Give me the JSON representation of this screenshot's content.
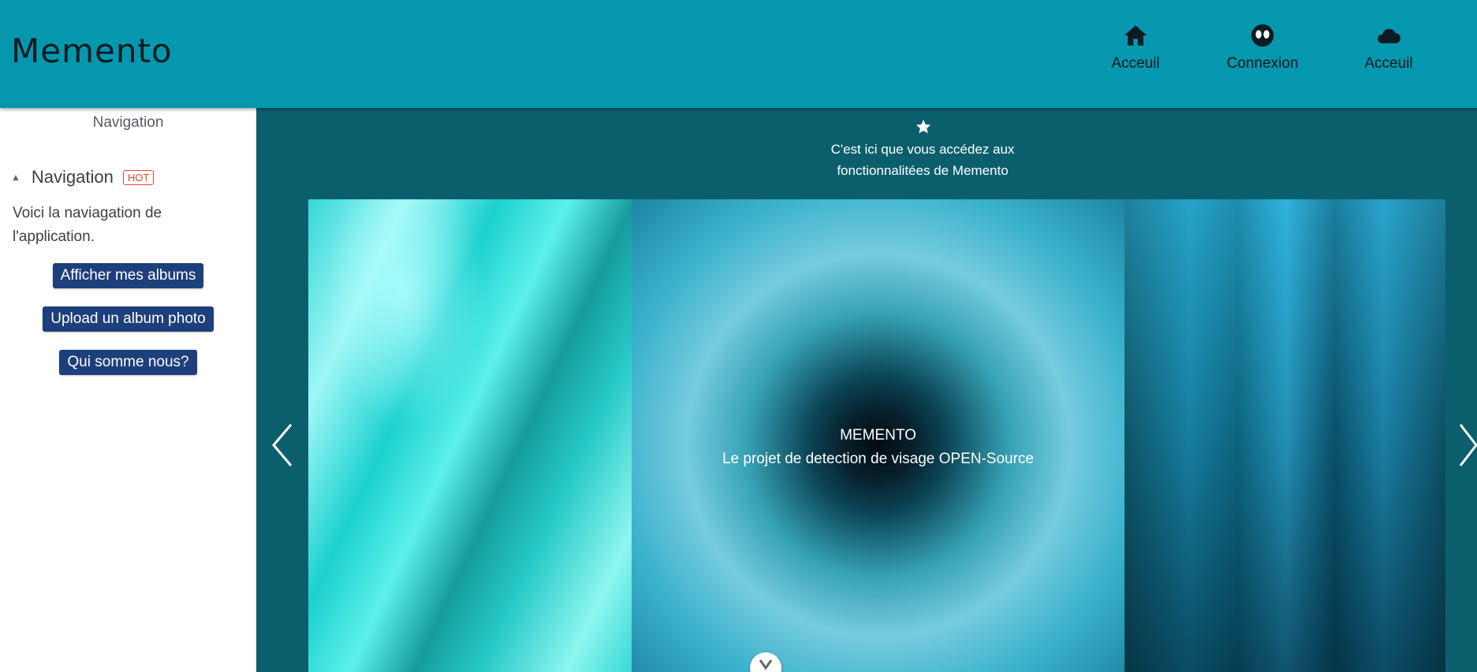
{
  "header": {
    "app_title": "Memento",
    "nav": [
      {
        "label": "Acceuil",
        "icon": "home-icon"
      },
      {
        "label": "Connexion",
        "icon": "alien-icon"
      },
      {
        "label": "Acceuil",
        "icon": "cloud-icon"
      }
    ]
  },
  "sidebar": {
    "heading": "Navigation",
    "section_title": "Navigation",
    "badge": "HOT",
    "description": "Voici la naviagation de l'application.",
    "buttons": [
      {
        "label": "Afficher mes albums"
      },
      {
        "label": "Upload un album photo"
      },
      {
        "label": "Qui somme nous?"
      }
    ]
  },
  "main": {
    "intro": "C'est ici que vous accédez aux fonctionnalitées de Memento",
    "carousel": {
      "caption_title": "MEMENTO",
      "caption_subtitle": "Le projet de detection de visage OPEN-Source"
    }
  },
  "colors": {
    "header": "#0497ae",
    "main_bg": "#0b5f6d",
    "button": "#1d3f7b",
    "badge": "#e04a2f"
  }
}
